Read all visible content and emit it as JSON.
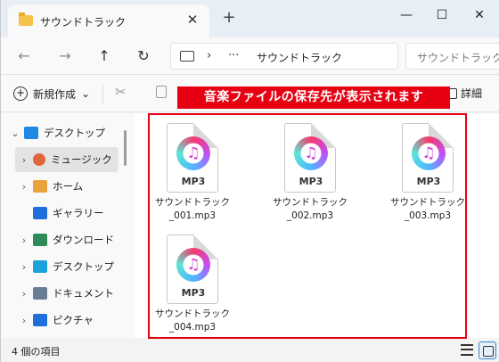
{
  "window": {
    "tab_title": "サウンドトラック",
    "tab_close": "✕",
    "new_tab": "+",
    "minimize": "—",
    "maximize": "☐",
    "close": "✕"
  },
  "nav": {
    "back": "←",
    "forward": "→",
    "up": "↑",
    "refresh": "↻",
    "separator": "›",
    "ellipsis": "···",
    "breadcrumb": "サウンドトラック",
    "search_placeholder": "サウンドトラックの検索"
  },
  "commands": {
    "new_label": "新規作成",
    "new_chevron": "⌄",
    "cut": "✂",
    "details_label": "詳細"
  },
  "annotation": {
    "text": "音楽ファイルの保存先が表示されます"
  },
  "sidebar": {
    "items": [
      {
        "label": "デスクトップ",
        "chevron": "⌄",
        "icon": "desktop-icon",
        "color": "#1e88e5"
      },
      {
        "label": "ミュージック",
        "chevron": "›",
        "icon": "music-icon",
        "color": "#e0663a"
      },
      {
        "label": "ホーム",
        "chevron": "›",
        "icon": "home-icon",
        "color": "#e8a23c"
      },
      {
        "label": "ギャラリー",
        "chevron": "",
        "icon": "gallery-icon",
        "color": "#1e6fd9"
      },
      {
        "label": "ダウンロード",
        "chevron": "›",
        "icon": "download-icon",
        "color": "#2e8b57"
      },
      {
        "label": "デスクトップ",
        "chevron": "›",
        "icon": "desktop-icon",
        "color": "#1aa3d8"
      },
      {
        "label": "ドキュメント",
        "chevron": "›",
        "icon": "document-icon",
        "color": "#6b7d94"
      },
      {
        "label": "ピクチャ",
        "chevron": "›",
        "icon": "pictures-icon",
        "color": "#1e6fd9"
      }
    ]
  },
  "files": [
    {
      "ext": "MP3",
      "name_line1": "サウンドトラック",
      "name_line2": "_001.mp3"
    },
    {
      "ext": "MP3",
      "name_line1": "サウンドトラック",
      "name_line2": "_002.mp3"
    },
    {
      "ext": "MP3",
      "name_line1": "サウンドトラック",
      "name_line2": "_003.mp3"
    },
    {
      "ext": "MP3",
      "name_line1": "サウンドトラック",
      "name_line2": "_004.mp3"
    }
  ],
  "status": {
    "item_count": "4 個の項目"
  },
  "colors": {
    "accent_red": "#e60012",
    "selection": "#e3e3e3",
    "view_active": "#3b82c4"
  }
}
